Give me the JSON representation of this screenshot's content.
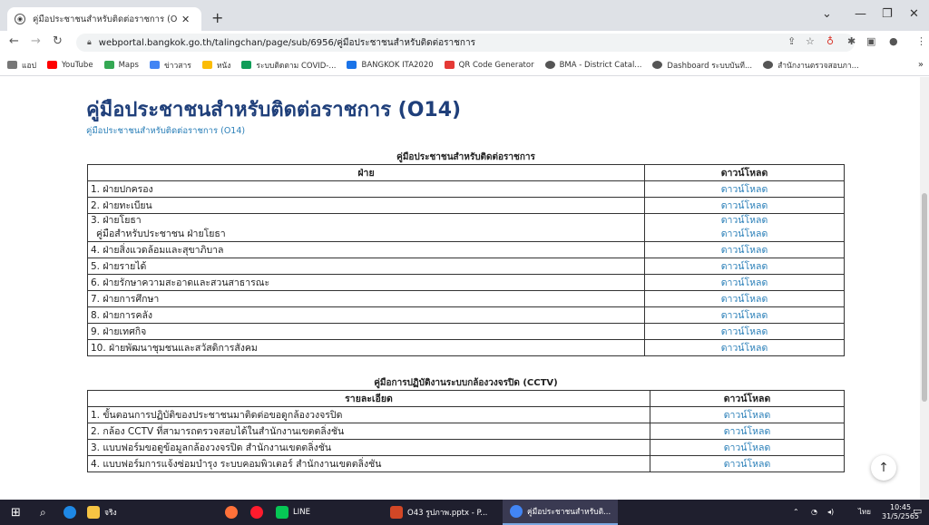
{
  "browser": {
    "tab_title": "คู่มือประชาชนสำหรับติดต่อราชการ (O",
    "url": "webportal.bangkok.go.th/talingchan/page/sub/6956/คู่มือประชาชนสำหรับติดต่อราชการ",
    "bookmarks": [
      {
        "label": "แอป",
        "color": "#777777"
      },
      {
        "label": "YouTube",
        "color": "#ff0000"
      },
      {
        "label": "Maps",
        "color": "#34a853"
      },
      {
        "label": "ข่าวสาร",
        "color": "#4285f4"
      },
      {
        "label": "หนัง",
        "color": "#fbbc05"
      },
      {
        "label": "ระบบติดตาม COVID-...",
        "color": "#0f9d58"
      },
      {
        "label": "BANGKOK ITA2020",
        "color": "#1a73e8"
      },
      {
        "label": "QR Code Generator",
        "color": "#e53935"
      },
      {
        "label": "BMA - District Catal...",
        "color": "#555555"
      },
      {
        "label": "Dashboard ระบบบันที...",
        "color": "#555555"
      },
      {
        "label": "สำนักงานตรวจสอบภา...",
        "color": "#555555"
      }
    ]
  },
  "page": {
    "title": "คู่มือประชาชนสำหรับติดต่อราชการ (O14)",
    "breadcrumb": "คู่มือประชาชนสำหรับติดต่อราชการ (O14)"
  },
  "table1": {
    "caption": "คู่มือประชาชนสำหรับติดต่อราชการ",
    "headers": [
      "ฝ่าย",
      "ดาวน์โหลด"
    ],
    "rows": [
      {
        "name": "1. ฝ่ายปกครอง",
        "sub": "",
        "dl": [
          "ดาวน์โหลด"
        ]
      },
      {
        "name": "2. ฝ่ายทะเบียน",
        "sub": "",
        "dl": [
          "ดาวน์โหลด"
        ]
      },
      {
        "name": "3. ฝ่ายโยธา",
        "sub": "คู่มือสำหรับประชาชน ฝ่ายโยธา",
        "dl": [
          "ดาวน์โหลด",
          "ดาวน์โหลด"
        ]
      },
      {
        "name": "4. ฝ่ายสิ่งแวดล้อมและสุขาภิบาล",
        "sub": "",
        "dl": [
          "ดาวน์โหลด"
        ]
      },
      {
        "name": "5. ฝ่ายรายได้",
        "sub": "",
        "dl": [
          "ดาวน์โหลด"
        ]
      },
      {
        "name": "6. ฝ่ายรักษาความสะอาดและสวนสาธารณะ",
        "sub": "",
        "dl": [
          "ดาวน์โหลด"
        ]
      },
      {
        "name": "7. ฝ่ายการศึกษา",
        "sub": "",
        "dl": [
          "ดาวน์โหลด"
        ]
      },
      {
        "name": "8. ฝ่ายการคลัง",
        "sub": "",
        "dl": [
          "ดาวน์โหลด"
        ]
      },
      {
        "name": "9. ฝ่ายเทศกิจ",
        "sub": "",
        "dl": [
          "ดาวน์โหลด"
        ]
      },
      {
        "name": "10. ฝ่ายพัฒนาชุมชนและสวัสดิการสังคม",
        "sub": "",
        "dl": [
          "ดาวน์โหลด"
        ]
      }
    ]
  },
  "table2": {
    "caption": "คู่มือการปฏิบัติงานระบบกล้องวงจรปิด (CCTV)",
    "headers": [
      "รายละเอียด",
      "ดาวน์โหลด"
    ],
    "rows": [
      {
        "name": "1. ขั้นตอนการปฏิบัติของประชาชนมาติดต่อขอดูกล้องวงจรปิด",
        "dl": "ดาวน์โหลด"
      },
      {
        "name": "2. กล้อง CCTV ที่สามารถตรวจสอบได้ในสำนักงานเขตตลิ่งชัน",
        "dl": "ดาวน์โหลด"
      },
      {
        "name": "3. แบบฟอร์มขอดูข้อมูลกล้องวงจรปิด สำนักงานเขตตลิ่งชัน",
        "dl": "ดาวน์โหลด"
      },
      {
        "name": "4. แบบฟอร์มการแจ้งซ่อมบำรุง ระบบคอมพิวเตอร์ สำนักงานเขตตลิ่งชัน",
        "dl": "ดาวน์โหลด"
      }
    ]
  },
  "taskbar": {
    "items": [
      {
        "label": "จริง"
      },
      {
        "label": "LINE"
      },
      {
        "label": "O43 รูปภาพ.pptx - P..."
      },
      {
        "label": "คู่มือประชาชนสำหรับติ..."
      }
    ],
    "lang": "ไทย",
    "time": "10:45",
    "date": "31/5/2565"
  }
}
